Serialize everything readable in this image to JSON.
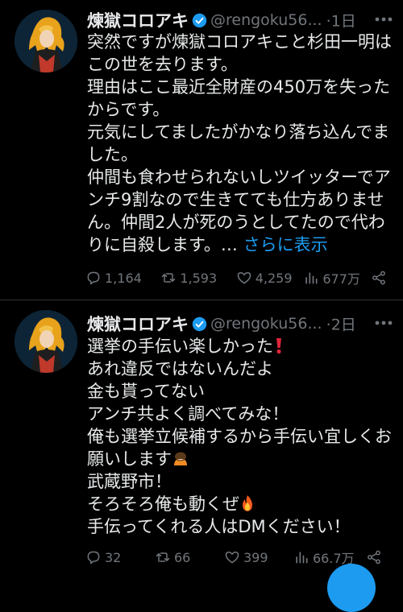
{
  "tweets": [
    {
      "name": "煉獄コロアキ",
      "handle": "@rengoku56...",
      "time": "·1日",
      "text": "突然ですが煉獄コロアキこと杉田一明はこの世を去ります。\n理由はここ最近全財産の450万を失ったからです。\n元気にしてましたがかなり落ち込んでました。\n仲間も食わせられないしツイッターでアンチ9割なので生きてても仕方ありません。仲間2人が死のうとしてたので代わりに自殺します。… ",
      "show_more": "さらに表示",
      "replies": "1,164",
      "retweets": "1,593",
      "likes": "4,259",
      "views": "677万"
    },
    {
      "name": "煉獄コロアキ",
      "handle": "@rengoku56...",
      "time": "·2日",
      "line1": "選挙の手伝い楽しかった",
      "line2": "あれ違反ではないんだよ\n金も貰ってない\nアンチ共よく調べてみな！\n俺も選挙立候補するから手伝い宜しくお願いします",
      "line3": "武蔵野市！\nそろそろ俺も動くぜ",
      "line4": "手伝ってくれる人はDMください！",
      "replies": "32",
      "retweets": "66",
      "likes": "399",
      "views": "66.7万"
    }
  ],
  "colors": {
    "background": "#000000",
    "text": "#e7e9ea",
    "muted": "#71767b",
    "accent": "#1d9bf0",
    "verified": "#1d9bf0"
  },
  "icons": [
    "verified-badge-icon",
    "more-icon",
    "reply-icon",
    "retweet-icon",
    "like-icon",
    "views-icon",
    "share-icon"
  ]
}
